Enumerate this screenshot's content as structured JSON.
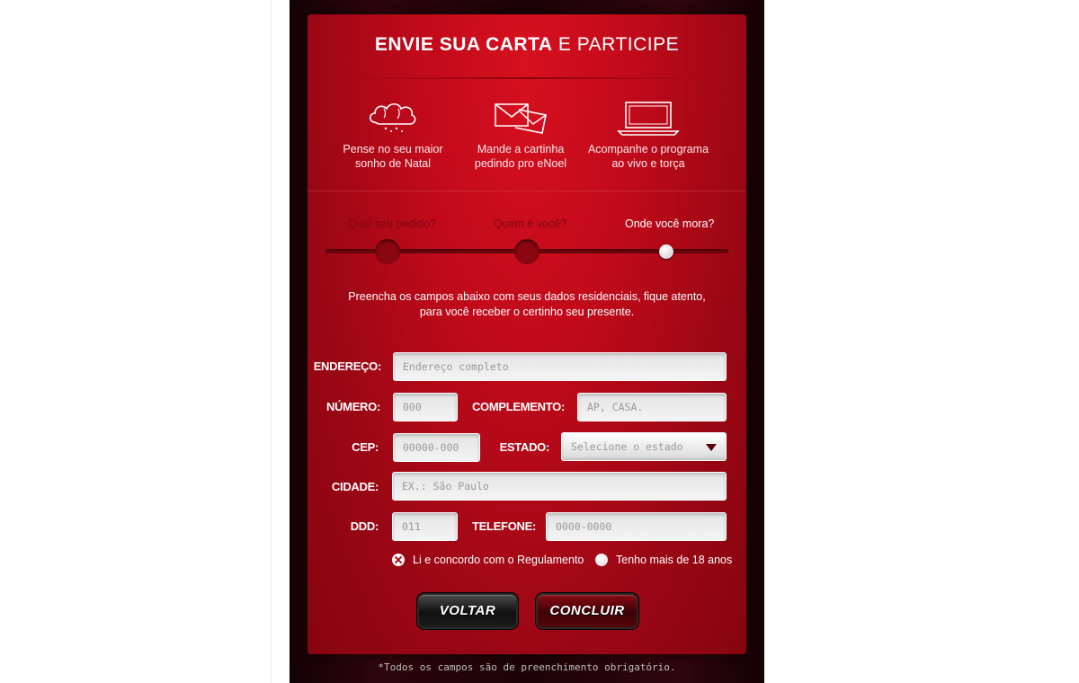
{
  "header": {
    "title_bold": "ENVIE SUA CARTA",
    "title_light": "E PARTICIPE"
  },
  "steps": [
    {
      "icon": "cloud-icon",
      "line1": "Pense no seu maior",
      "line2": "sonho de Natal"
    },
    {
      "icon": "envelope-icon",
      "line1": "Mande a cartinha",
      "line2": "pedindo pro eNoel"
    },
    {
      "icon": "laptop-icon",
      "line1": "Acompanhe o programa",
      "line2": "ao vivo e torça"
    }
  ],
  "progress": {
    "stages": [
      "Qual seu pedido?",
      "Quem é você?",
      "Onde você mora?"
    ],
    "current": "Onde você mora?"
  },
  "instructions": {
    "line1": "Preencha os campos abaixo com seus dados residenciais, fique atento,",
    "line2": "para você receber o certinho seu presente."
  },
  "form": {
    "endereco": {
      "label": "ENDEREÇO:",
      "placeholder": "Endereço completo"
    },
    "numero": {
      "label": "NÚMERO:",
      "placeholder": "000"
    },
    "complemento": {
      "label": "COMPLEMENTO:",
      "placeholder": "AP, CASA."
    },
    "cep": {
      "label": "CEP:",
      "placeholder": "00000-000"
    },
    "estado": {
      "label": "ESTADO:",
      "selected": "Selecione o estado"
    },
    "cidade": {
      "label": "CIDADE:",
      "placeholder": "EX.: São Paulo"
    },
    "ddd": {
      "label": "DDD:",
      "placeholder": "011"
    },
    "telefone": {
      "label": "TELEFONE:",
      "placeholder": "0000-0000"
    }
  },
  "checks": {
    "regulamento": "Li e concordo com o Regulamento",
    "idade": "Tenho mais de 18 anos"
  },
  "buttons": {
    "back": "VOLTAR",
    "submit": "CONCLUIR"
  },
  "footnote": "*Todos os campos são de preenchimento obrigatório."
}
